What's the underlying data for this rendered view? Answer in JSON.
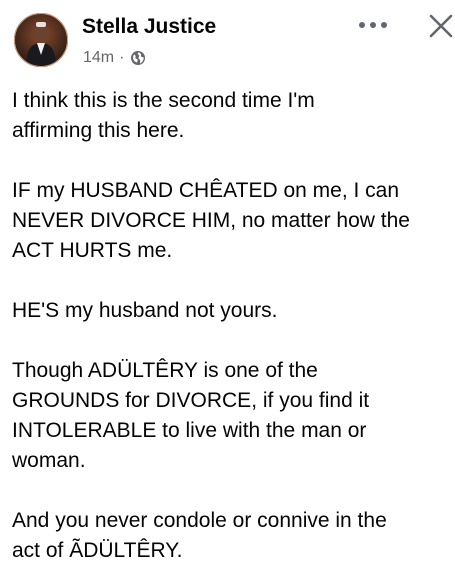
{
  "post": {
    "author": "Stella Justice",
    "time": "14m",
    "separator": "·",
    "audience_icon": "globe-icon",
    "paragraphs": [
      "I think this is the second time I'm\naffirming this here.",
      "IF my HUSBAND CHÊATED on me, I can\nNEVER DIVORCE HIM, no matter how the\nACT HURTS me.",
      "HE'S my husband not yours.",
      "Though ADÜLTÊRY is one of the\nGROUNDS for DIVORCE, if you find it\nINTOLERABLE to live with the man or\nwoman.",
      "And you never condole or connive in the\nact of ÃDÜLTÊRY."
    ]
  },
  "icons": {
    "more": "more-horizontal-icon",
    "close": "close-icon"
  },
  "colors": {
    "text": "#050505",
    "secondary_text": "#65676b",
    "icon": "#606770"
  }
}
